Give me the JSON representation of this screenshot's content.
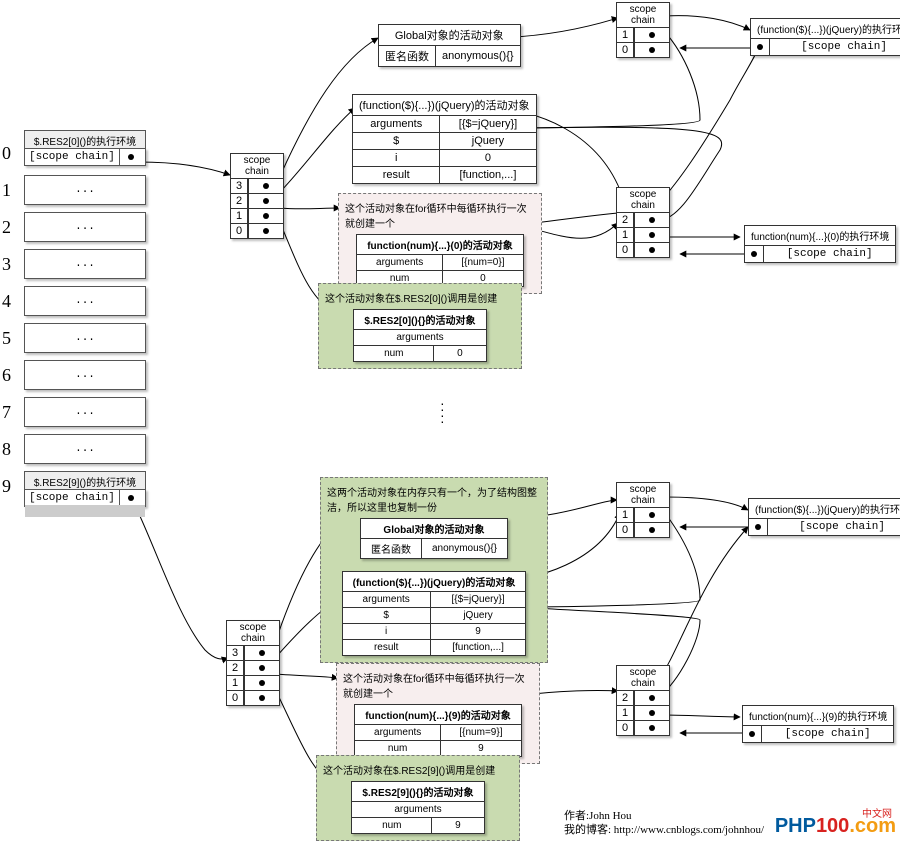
{
  "left_numbers": [
    "0",
    "1",
    "2",
    "3",
    "4",
    "5",
    "6",
    "7",
    "8",
    "9"
  ],
  "res2": {
    "header0": "$.RES2[0]()的执行环境",
    "header9": "$.RES2[9]()的执行环境",
    "scope_chain_label": "[scope chain]",
    "placeholder": "..."
  },
  "scope_chain_label": "scope chain",
  "scope3": [
    "3",
    "2",
    "1",
    "0"
  ],
  "scope2": [
    "1",
    "0"
  ],
  "scope3b": [
    "2",
    "1",
    "0"
  ],
  "global_box": {
    "title": "Global对象的活动对象",
    "row_l": "匿名函数",
    "row_r": "anonymous(){}"
  },
  "jq_box": {
    "title": "(function($){...})(jQuery)的活动对象",
    "rows": [
      [
        "arguments",
        "[{$=jQuery}]"
      ],
      [
        "$",
        "jQuery"
      ],
      [
        "i",
        "0"
      ],
      [
        "result",
        "[function,...]"
      ]
    ]
  },
  "pink_top": {
    "note": "这个活动对象在for循环中每循环执行一次就创建一个",
    "title": "function(num){...}(0)的活动对象",
    "rows": [
      [
        "arguments",
        "[{num=0}]"
      ],
      [
        "num",
        "0"
      ]
    ]
  },
  "green_top": {
    "note": "这个活动对象在$.RES2[0]()调用是创建",
    "title": "$.RES2[0](){}的活动对象",
    "rows": [
      [
        "arguments",
        ""
      ],
      [
        "num",
        "0"
      ]
    ]
  },
  "exec_env1": {
    "title": "(function($){...})(jQuery)的执行环境",
    "link": "[scope chain]"
  },
  "exec_env2": {
    "title": "function(num){...}(0)的执行环境",
    "link": "[scope chain]"
  },
  "vertical_ellipsis": "⋮",
  "green_big": {
    "note": "这两个活动对象在内存只有一个，为了结构图整洁，所以这里也复制一份",
    "global_title": "Global对象的活动对象",
    "global_l": "匿名函数",
    "global_r": "anonymous(){}",
    "jq_title": "(function($){...})(jQuery)的活动对象",
    "jq_rows": [
      [
        "arguments",
        "[{$=jQuery}]"
      ],
      [
        "$",
        "jQuery"
      ],
      [
        "i",
        "9"
      ],
      [
        "result",
        "[function,...]"
      ]
    ]
  },
  "pink_bot": {
    "note": "这个活动对象在for循环中每循环执行一次就创建一个",
    "title": "function(num){...}(9)的活动对象",
    "rows": [
      [
        "arguments",
        "[{num=9}]"
      ],
      [
        "num",
        "9"
      ]
    ]
  },
  "green_bot": {
    "note": "这个活动对象在$.RES2[9]()调用是创建",
    "title": "$.RES2[9](){}的活动对象",
    "rows": [
      [
        "arguments",
        ""
      ],
      [
        "num",
        "9"
      ]
    ]
  },
  "exec_env_bot1": {
    "title": "(function($){...})(jQuery)的执行环境",
    "link": "[scope chain]"
  },
  "exec_env_bot2": {
    "title": "function(num){...}(9)的执行环境",
    "link": "[scope chain]"
  },
  "author": {
    "l1": "作者:John Hou",
    "l2": "我的博客: http://www.cnblogs.com/johnhou/"
  },
  "brand": {
    "p": "PHP",
    "num": "100",
    "com": ".com",
    "sub": "中文网"
  }
}
